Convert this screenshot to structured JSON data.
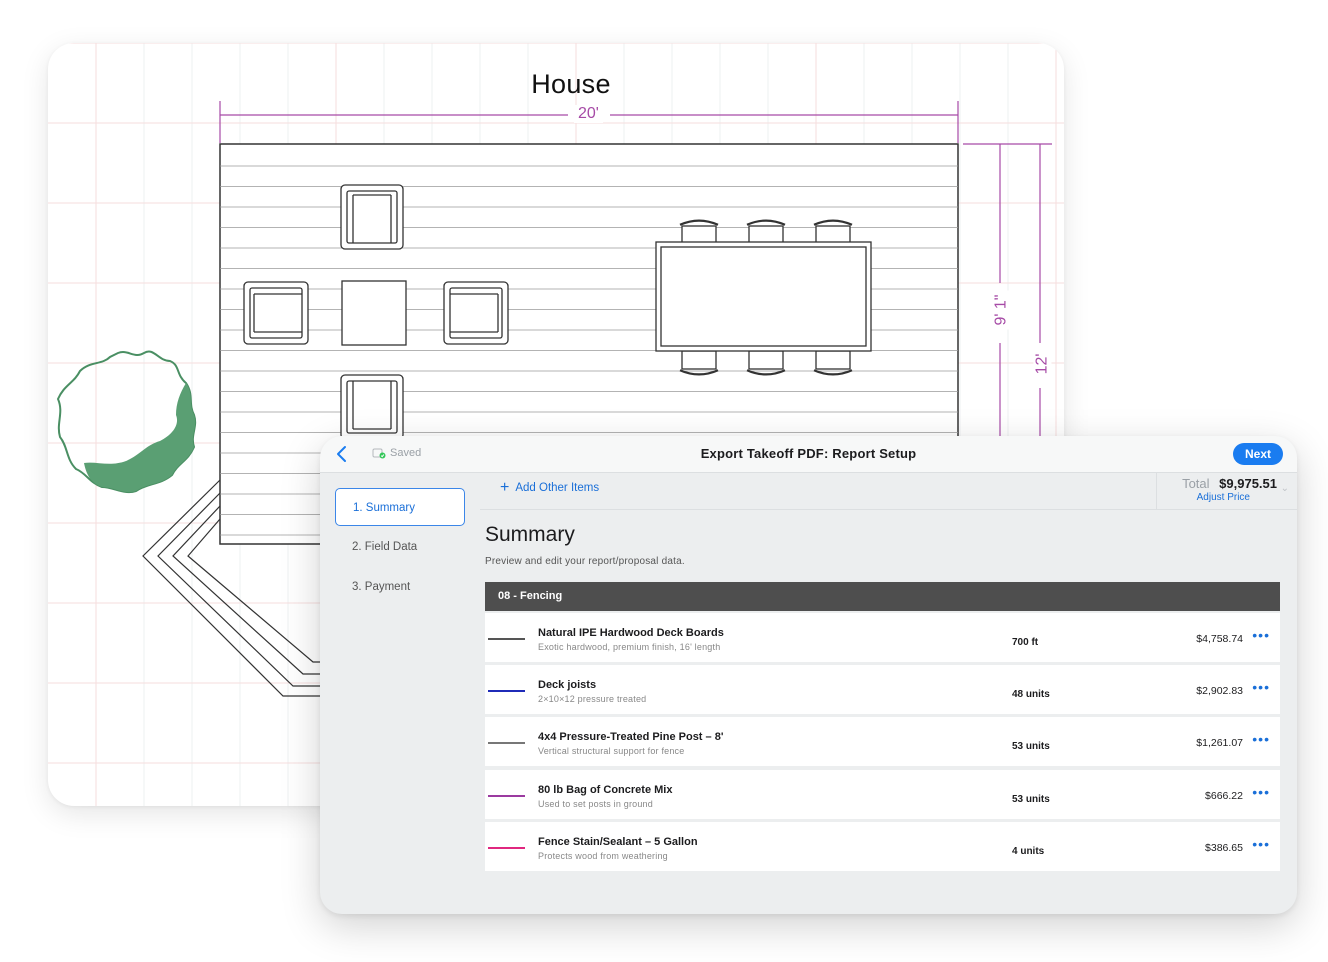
{
  "plan": {
    "title": "House",
    "dim_width": "20'",
    "dim_height_inner": "9' 1\"",
    "dim_height_outer": "12'"
  },
  "panel": {
    "saved_label": "Saved",
    "title": "Export Takeoff PDF: Report Setup",
    "next_label": "Next",
    "steps": [
      "1. Summary",
      "2. Field Data",
      "3. Payment"
    ],
    "add_items_label": "Add Other Items",
    "total_label": "Total",
    "total_value": "$9,975.51",
    "adjust_price_label": "Adjust Price",
    "summary_title": "Summary",
    "summary_subtitle": "Preview and edit your report/proposal data.",
    "section_title": "08 - Fencing",
    "items": [
      {
        "name": "Natural IPE Hardwood Deck Boards",
        "desc": "Exotic hardwood, premium finish, 16' length",
        "qty": "700 ft",
        "price": "$4,758.74",
        "color": "#555555"
      },
      {
        "name": "Deck joists",
        "desc": "2×10×12 pressure treated",
        "qty": "48 units",
        "price": "$2,902.83",
        "color": "#1f2bb8"
      },
      {
        "name": "4x4 Pressure-Treated Pine Post – 8'",
        "desc": "Vertical structural support for fence",
        "qty": "53 units",
        "price": "$1,261.07",
        "color": "#777777"
      },
      {
        "name": "80 lb Bag of Concrete Mix",
        "desc": "Used to set posts in ground",
        "qty": "53 units",
        "price": "$666.22",
        "color": "#9b3aa0"
      },
      {
        "name": "Fence Stain/Sealant – 5 Gallon",
        "desc": "Protects wood from weathering",
        "qty": "4 units",
        "price": "$386.65",
        "color": "#e0277f"
      }
    ]
  },
  "colors": {
    "accent": "#1a7cf0",
    "dimension": "#a64aa6",
    "tree": "#5a9f73"
  }
}
